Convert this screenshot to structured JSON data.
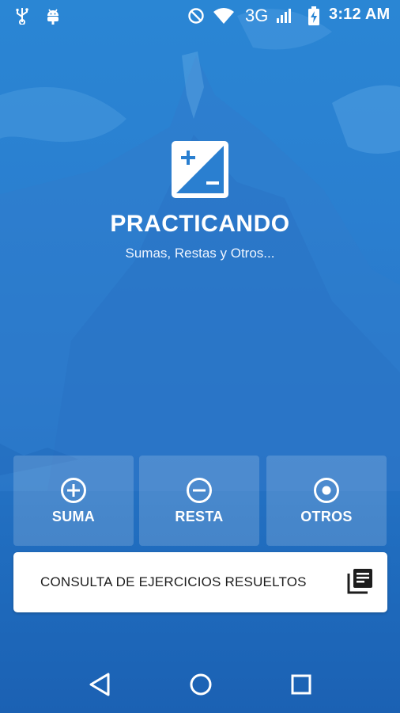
{
  "status_bar": {
    "network": "3G",
    "time": "3:12 AM",
    "icons": [
      "usb-icon",
      "android-debug-icon",
      "do-not-disturb-icon",
      "wifi-icon",
      "signal-icon",
      "battery-charging-icon"
    ]
  },
  "app": {
    "title": "PRACTICANDO",
    "subtitle": "Sumas, Restas y Otros...",
    "logo_icon": "plus-minus-icon"
  },
  "operations": [
    {
      "label": "SUMA",
      "icon": "plus-circle-icon"
    },
    {
      "label": "RESTA",
      "icon": "minus-circle-icon"
    },
    {
      "label": "OTROS",
      "icon": "radio-circle-icon"
    }
  ],
  "consulta": {
    "label": "CONSULTA DE EJERCICIOS RESUELTOS",
    "icon": "library-books-icon"
  },
  "nav_bar": {
    "icons": [
      "back-icon",
      "home-icon",
      "recents-icon"
    ]
  },
  "colors": {
    "background_top": "#2a86d4",
    "background_bottom": "#1b61b3",
    "card_fill": "rgba(255,255,255,0.17)",
    "button_fill": "#ffffff",
    "button_text": "#1d1d1d"
  }
}
